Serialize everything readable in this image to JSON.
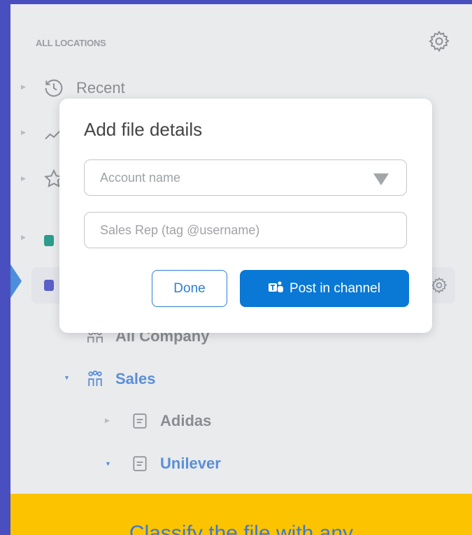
{
  "sidebar": {
    "header": "ALL LOCATIONS",
    "items": [
      {
        "label": "Recent",
        "icon": "recent-icon"
      },
      {
        "label": "",
        "icon": "activity-icon"
      },
      {
        "label": "",
        "icon": "star-icon"
      },
      {
        "label": "",
        "icon": "sharepoint-icon"
      },
      {
        "label": "",
        "icon": "teams-icon",
        "selected": true
      }
    ],
    "tree": [
      {
        "label": "All Company",
        "icon": "team-icon"
      },
      {
        "label": "Sales",
        "icon": "team-icon",
        "expanded": true
      },
      {
        "label": "Adidas",
        "icon": "channel-icon"
      },
      {
        "label": "Unilever",
        "icon": "channel-icon",
        "expanded": true
      }
    ]
  },
  "dialog": {
    "title": "Add file details",
    "account_placeholder": "Account name",
    "salesrep_placeholder": "Sales Rep (tag @username)",
    "done_label": "Done",
    "post_label": "Post in channel",
    "post_icon": "teams-icon"
  },
  "banner": {
    "text": "Classify the file with any"
  },
  "colors": {
    "accent": "#0a78d5",
    "selection_marker": "#4b8ed9",
    "banner_bg": "#fcc400",
    "frame_bg": "#4a4fc0"
  }
}
